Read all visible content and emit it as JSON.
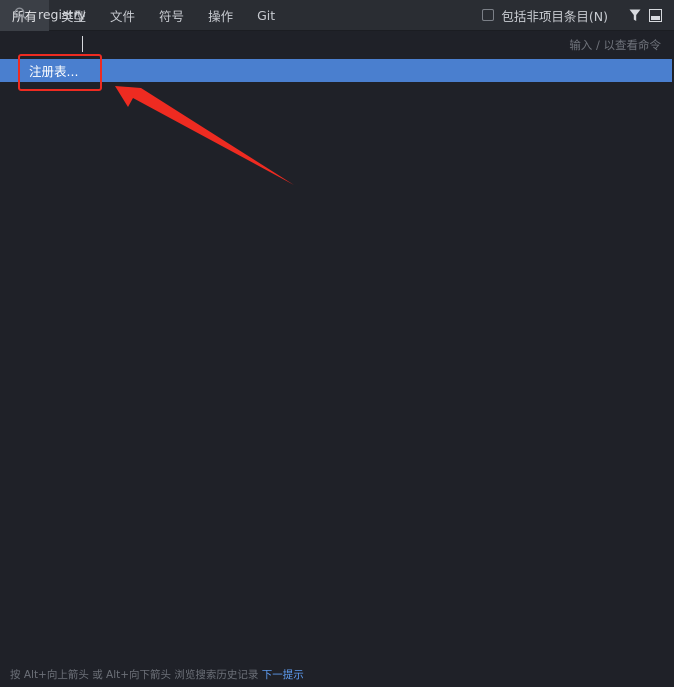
{
  "tabs": [
    {
      "label": "所有",
      "active": true
    },
    {
      "label": "类型",
      "active": false
    },
    {
      "label": "文件",
      "active": false
    },
    {
      "label": "符号",
      "active": false
    },
    {
      "label": "操作",
      "active": false
    },
    {
      "label": "Git",
      "active": false
    }
  ],
  "options": {
    "include_non_project_label": "包括非项目条目(N)",
    "include_non_project_checked": false
  },
  "icons": {
    "filter": "filter-icon",
    "preview": "preview-panel-icon",
    "search": "search-icon"
  },
  "search": {
    "value": "registry",
    "hint": "输入 / 以查看命令"
  },
  "results": [
    {
      "label": "注册表..."
    }
  ],
  "footer": {
    "text": "按 Alt+向上箭头 或 Alt+向下箭头 浏览搜索历史记录",
    "link": "下一提示"
  },
  "colors": {
    "background": "#1f2128",
    "toolbar": "#2a2d33",
    "selection": "#4a7fcf",
    "annotation": "#ee2b21",
    "link": "#5e9bef"
  }
}
